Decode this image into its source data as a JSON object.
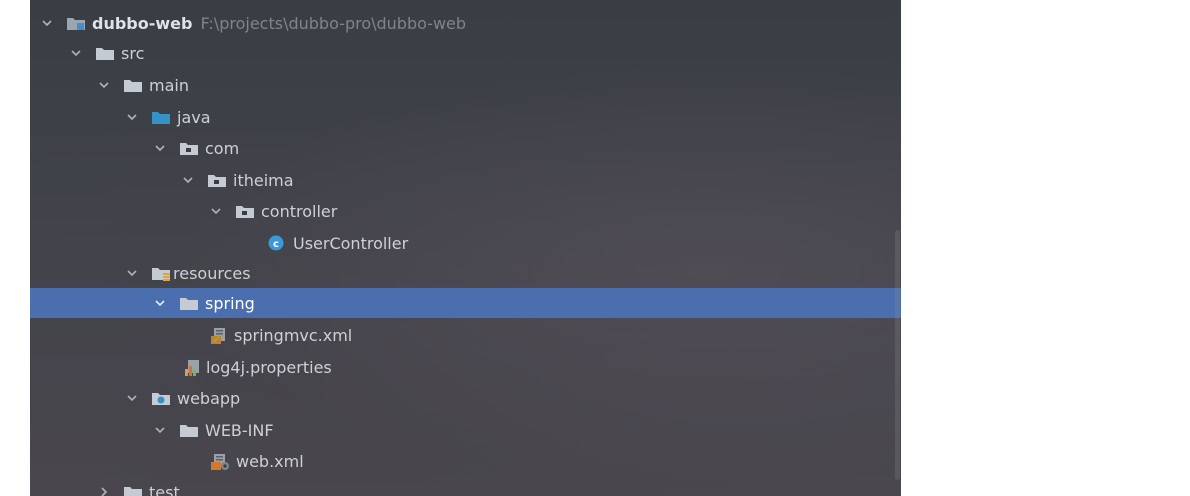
{
  "tree": {
    "items": [
      {
        "label": "dubbo-web",
        "path": "F:\\projects\\dubbo-pro\\dubbo-web"
      },
      {
        "label": "src"
      },
      {
        "label": "main"
      },
      {
        "label": "java"
      },
      {
        "label": "com"
      },
      {
        "label": "itheima"
      },
      {
        "label": "controller"
      },
      {
        "label": "UserController"
      },
      {
        "label": "resources"
      },
      {
        "label": "spring"
      },
      {
        "label": "springmvc.xml"
      },
      {
        "label": "log4j.properties"
      },
      {
        "label": "webapp"
      },
      {
        "label": "WEB-INF"
      },
      {
        "label": "web.xml"
      },
      {
        "label": "test"
      }
    ]
  },
  "icons": {
    "module": "module-folder-icon",
    "folder": "folder-icon",
    "source": "source-folder-icon",
    "package": "package-icon",
    "class": "java-class-icon",
    "resources": "resources-folder-icon",
    "xml": "xml-file-icon",
    "properties": "properties-file-icon",
    "web": "web-folder-icon"
  },
  "colors": {
    "selection": "#4b6eaf",
    "text": "#cdd1d6",
    "path": "#7f848c"
  }
}
